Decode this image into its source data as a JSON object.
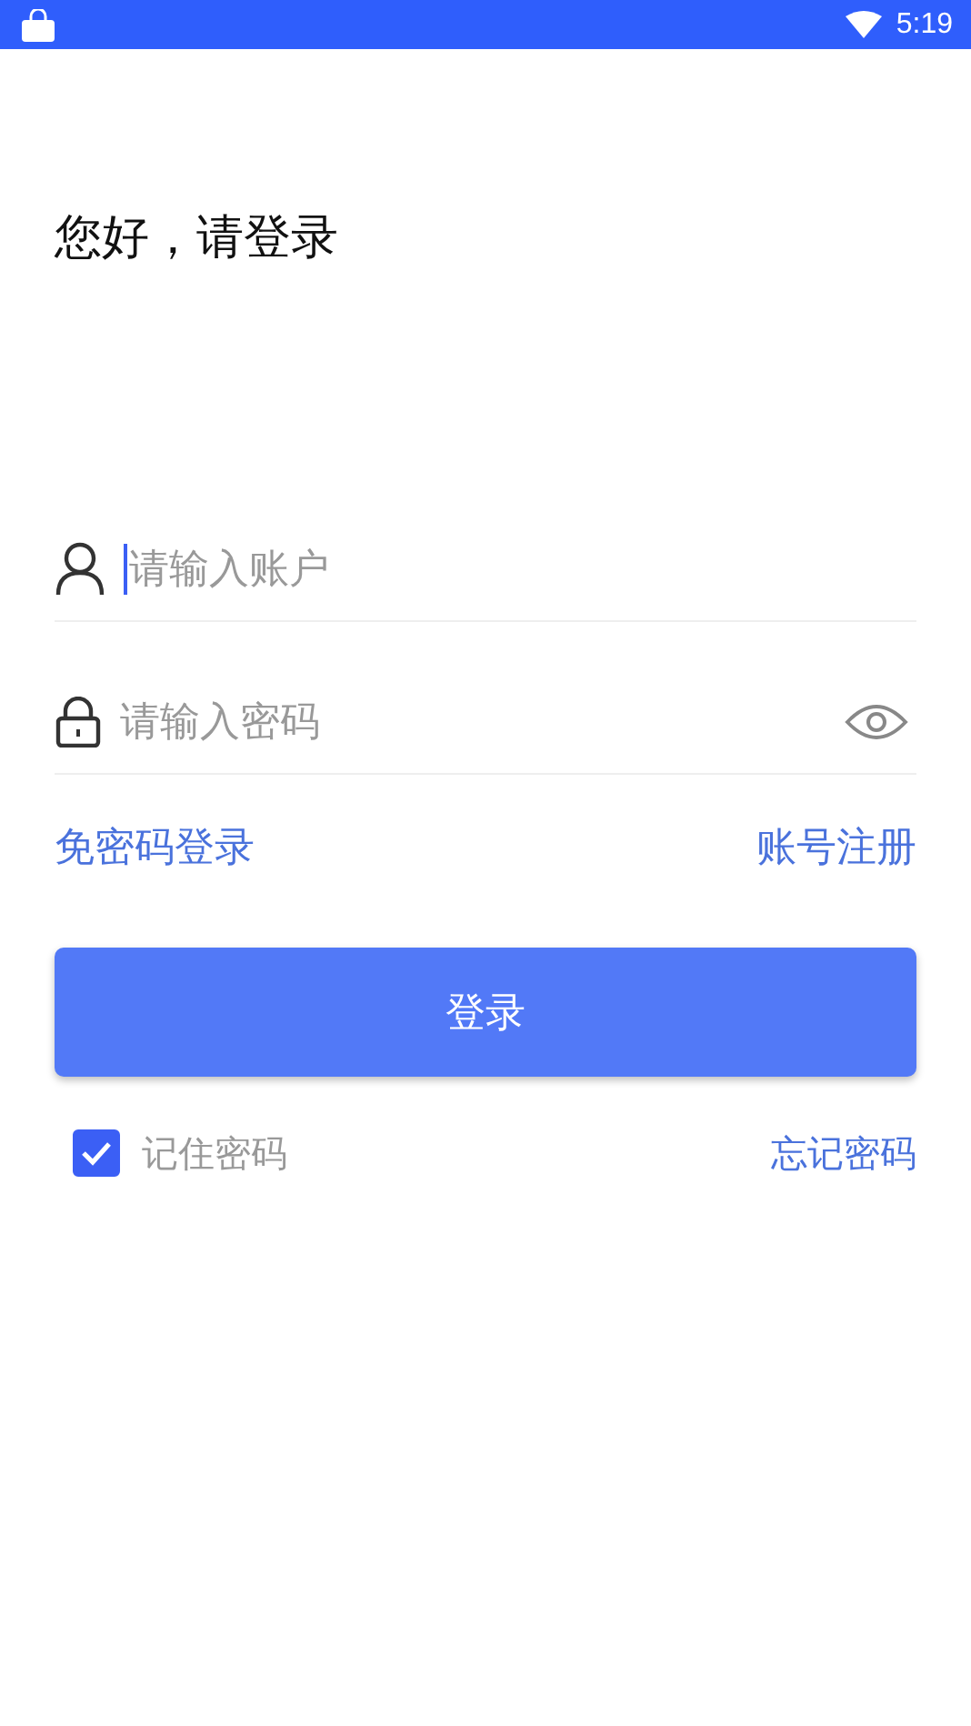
{
  "status_bar": {
    "time": "5:19"
  },
  "title": "您好，请登录",
  "fields": [
    {
      "kind": "account",
      "placeholder": "请输入账户",
      "focused": true
    },
    {
      "kind": "password",
      "placeholder": "请输入密码",
      "focused": false
    }
  ],
  "links": {
    "left": "免密码登录",
    "right": "账号注册"
  },
  "login_button": "登录",
  "remember": {
    "label": "记住密码",
    "checked": true
  },
  "forgot": "忘记密码"
}
